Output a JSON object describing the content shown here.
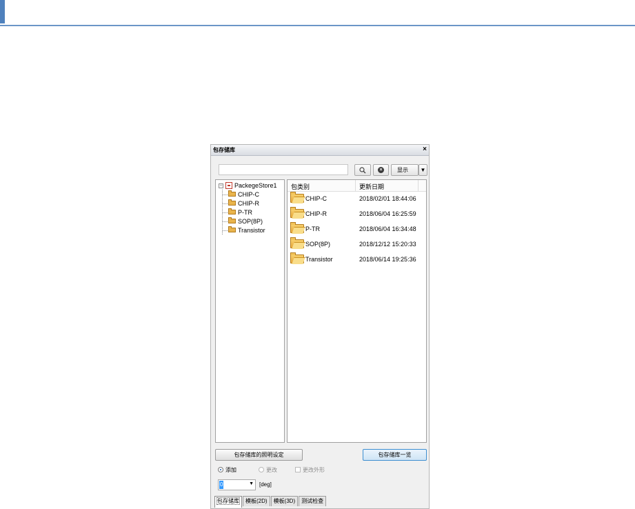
{
  "panel": {
    "title": "包存储库",
    "close": "×"
  },
  "toolbar": {
    "search_value": "",
    "search_icon": "search-icon",
    "clear_icon": "clear-icon",
    "display_label": "显示",
    "dropdown_arrow": "▼"
  },
  "tree": {
    "root_expander": "−",
    "root_label": "PackegeStore1",
    "items": [
      "CHIP-C",
      "CHIP-R",
      "P-TR",
      "SOP(8P)",
      "Transistor"
    ]
  },
  "list": {
    "columns": [
      "包类别",
      "更新日期"
    ],
    "rows": [
      {
        "name": "CHIP-C",
        "date": "2018/02/01 18:44:06"
      },
      {
        "name": "CHIP-R",
        "date": "2018/06/04 16:25:59"
      },
      {
        "name": "P-TR",
        "date": "2018/06/04 16:34:48"
      },
      {
        "name": "SOP(8P)",
        "date": "2018/12/12 15:20:33"
      },
      {
        "name": "Transistor",
        "date": "2018/06/14 19:25:36"
      }
    ]
  },
  "buttons": {
    "settings": "包存储库的照明设定",
    "list": "包存储库一览"
  },
  "options": {
    "add": "添加",
    "change": "更改",
    "change_shape": "更改外形"
  },
  "angle": {
    "value": "0",
    "unit": "[deg]",
    "arrow": "▼"
  },
  "tabs": [
    "包存储库",
    "模板(2D)",
    "模板(3D)",
    "测试检查"
  ],
  "colors": {
    "accent": "#4f81bd",
    "selection": "#3399ff"
  }
}
